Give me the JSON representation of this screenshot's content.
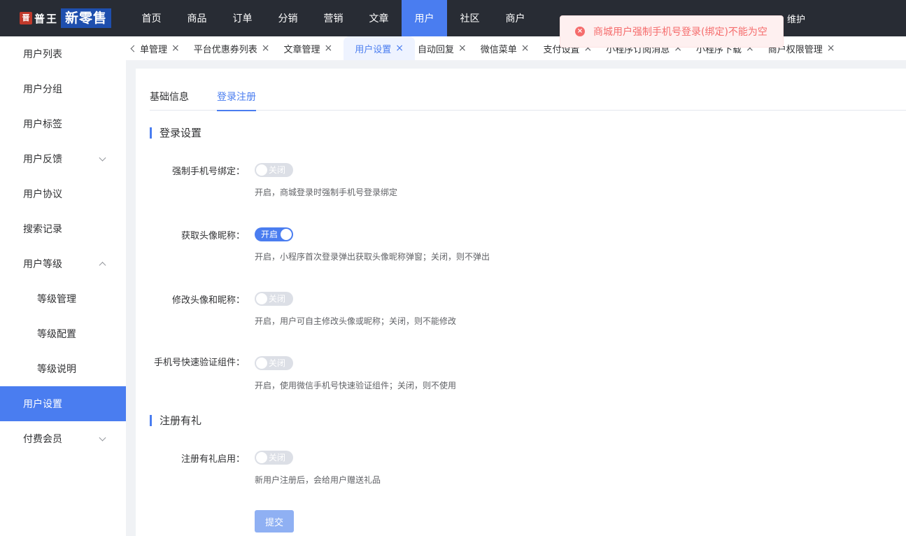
{
  "logo": {
    "seal": "晋",
    "name": "普王",
    "brand": "新零售"
  },
  "topnav": {
    "items": [
      {
        "label": "首页"
      },
      {
        "label": "商品"
      },
      {
        "label": "订单"
      },
      {
        "label": "分销"
      },
      {
        "label": "营销"
      },
      {
        "label": "文章"
      },
      {
        "label": "用户",
        "active": true
      },
      {
        "label": "社区"
      },
      {
        "label": "商户"
      }
    ],
    "right_item": "维护"
  },
  "sidebar": {
    "items": [
      {
        "label": "用户列表"
      },
      {
        "label": "用户分组"
      },
      {
        "label": "用户标签"
      },
      {
        "label": "用户反馈",
        "arrow": "down"
      },
      {
        "label": "用户协议"
      },
      {
        "label": "搜索记录"
      },
      {
        "label": "用户等级",
        "arrow": "up"
      },
      {
        "label": "等级管理",
        "sub": true
      },
      {
        "label": "等级配置",
        "sub": true
      },
      {
        "label": "等级说明",
        "sub": true
      },
      {
        "label": "用户设置",
        "active": true
      },
      {
        "label": "付费会员",
        "arrow": "down"
      }
    ]
  },
  "tabs": {
    "items": [
      {
        "label": "单管理"
      },
      {
        "label": "平台优惠券列表"
      },
      {
        "label": "文章管理"
      },
      {
        "label": "用户设置",
        "active": true
      },
      {
        "label": "自动回复"
      },
      {
        "label": "微信菜单"
      },
      {
        "label": "支付设置"
      },
      {
        "label": "小程序订阅消息"
      },
      {
        "label": "小程序下载"
      },
      {
        "label": "商户权限管理"
      }
    ],
    "close_glyph": "×"
  },
  "content": {
    "subtabs": [
      {
        "label": "基础信息"
      },
      {
        "label": "登录注册",
        "active": true
      }
    ],
    "section_login": "登录设置",
    "section_register": "注册有礼",
    "fields": [
      {
        "label": "强制手机号绑定：",
        "switch_on": false,
        "switch_text": "关闭",
        "hint": "开启，商城登录时强制手机号登录绑定"
      },
      {
        "label": "获取头像昵称：",
        "switch_on": true,
        "switch_text": "开启",
        "hint": "开启，小程序首次登录弹出获取头像昵称弹窗；关闭，则不弹出"
      },
      {
        "label": "修改头像和昵称：",
        "switch_on": false,
        "switch_text": "关闭",
        "hint": "开启，用户可自主修改头像或昵称；关闭，则不能修改"
      },
      {
        "label": "手机号快速验证组件：",
        "switch_on": false,
        "switch_text": "关闭",
        "hint": "开启，使用微信手机号快速验证组件；关闭，则不使用"
      },
      {
        "label": "注册有礼启用：",
        "switch_on": false,
        "switch_text": "关闭",
        "hint": "新用户注册后，会给用户赠送礼品"
      }
    ],
    "submit_label": "提交"
  },
  "toast": {
    "message": "商城用户强制手机号登录(绑定)不能为空",
    "icon": "×"
  },
  "colors": {
    "accent": "#4a7df0",
    "topbar": "#282c34",
    "error": "#f56c6c"
  }
}
